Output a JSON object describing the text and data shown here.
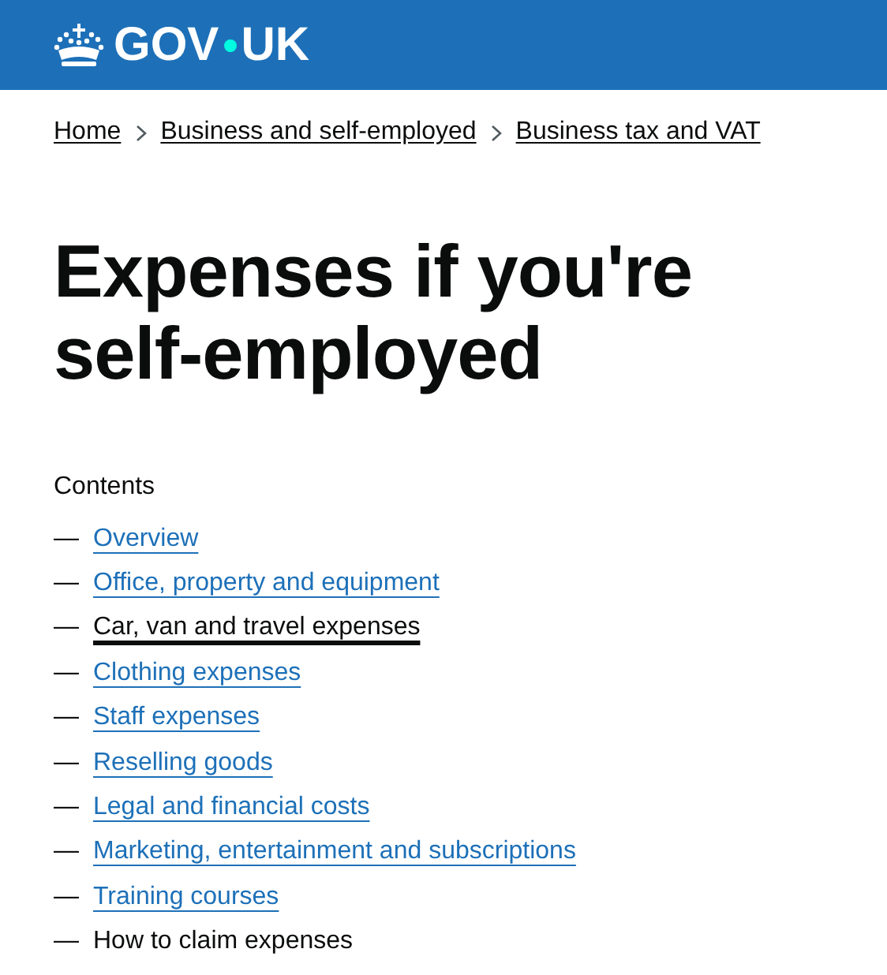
{
  "header": {
    "logo": {
      "left": "GOV",
      "right": "UK"
    }
  },
  "breadcrumbs": [
    {
      "label": "Home"
    },
    {
      "label": "Business and self-employed"
    },
    {
      "label": "Business tax and VAT"
    }
  ],
  "title": "Expenses if you're self-employed",
  "contents": {
    "heading": "Contents",
    "items": [
      {
        "dash": "—",
        "label": "Overview",
        "current": false,
        "hovered": false
      },
      {
        "dash": "—",
        "label": "Office, property and equipment",
        "current": false,
        "hovered": false
      },
      {
        "dash": "—",
        "label": "Car, van and travel expenses",
        "current": false,
        "hovered": true
      },
      {
        "dash": "—",
        "label": "Clothing expenses",
        "current": false,
        "hovered": false
      },
      {
        "dash": "—",
        "label": "Staff expenses",
        "current": false,
        "hovered": false
      },
      {
        "dash": "—",
        "label": "Reselling goods",
        "current": false,
        "hovered": false
      },
      {
        "dash": "—",
        "label": "Legal and financial costs",
        "current": false,
        "hovered": false
      },
      {
        "dash": "—",
        "label": "Marketing, entertainment and subscriptions",
        "current": false,
        "hovered": false
      },
      {
        "dash": "—",
        "label": "Training courses",
        "current": false,
        "hovered": false
      },
      {
        "dash": "—",
        "label": "How to claim expenses",
        "current": true,
        "hovered": false
      }
    ]
  }
}
